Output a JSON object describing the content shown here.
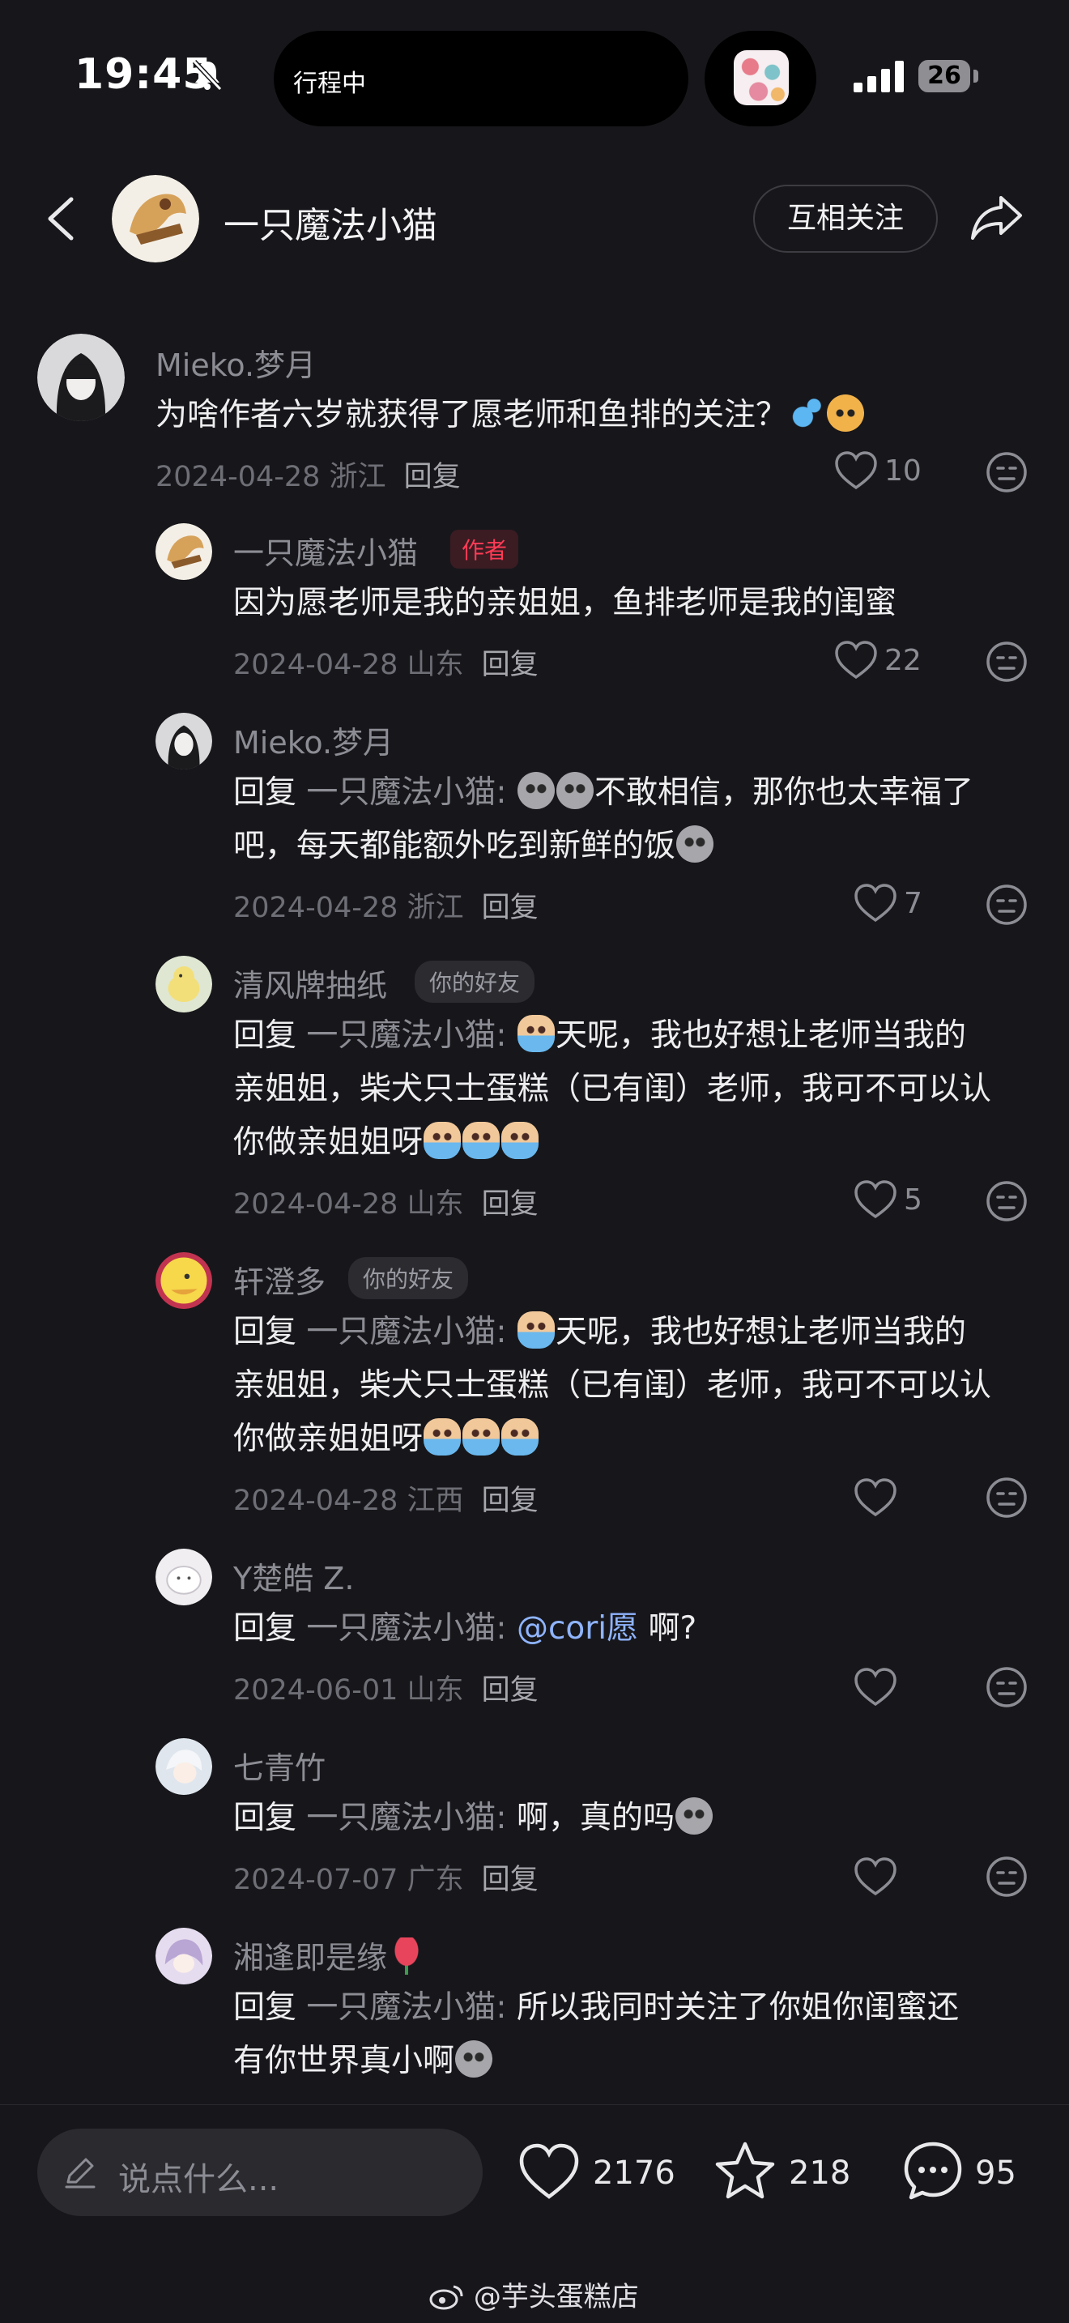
{
  "status": {
    "time": "19:45",
    "island_label": "行程中",
    "battery": "26"
  },
  "header": {
    "title": "一只魔法小猫",
    "follow_label": "互相关注"
  },
  "comments": [
    {
      "user": "Mieko.梦月",
      "text": "为啥作者六岁就获得了愿老师和鱼排的关注？",
      "date": "2024-04-28",
      "location": "浙江",
      "reply": "回复",
      "likes": "10"
    },
    {
      "user": "一只魔法小猫",
      "badge": "作者",
      "text": "因为愿老师是我的亲姐姐，鱼排老师是我的闺蜜",
      "date": "2024-04-28",
      "location": "山东",
      "reply": "回复",
      "likes": "22"
    },
    {
      "user": "Mieko.梦月",
      "reply_prefix": "回复",
      "reply_to": "一只魔法小猫:",
      "text1": "不敢相信，那你也太幸福了",
      "text2": "吧，每天都能额外吃到新鲜的饭",
      "date": "2024-04-28",
      "location": "浙江",
      "reply": "回复",
      "likes": "7"
    },
    {
      "user": "清风牌抽纸",
      "badge": "你的好友",
      "reply_prefix": "回复",
      "reply_to": "一只魔法小猫:",
      "text1": "天呢，我也好想让老师当我的",
      "text2": "亲姐姐，柴犬只士蛋糕（已有闺）老师，我可不可以认",
      "text3": "你做亲姐姐呀",
      "date": "2024-04-28",
      "location": "山东",
      "reply": "回复",
      "likes": "5"
    },
    {
      "user": "轩澄多",
      "badge": "你的好友",
      "reply_prefix": "回复",
      "reply_to": "一只魔法小猫:",
      "text1": "天呢，我也好想让老师当我的",
      "text2": "亲姐姐，柴犬只士蛋糕（已有闺）老师，我可不可以认",
      "text3": "你做亲姐姐呀",
      "date": "2024-04-28",
      "location": "江西",
      "reply": "回复",
      "likes": ""
    },
    {
      "user": "Y楚皓 Z.",
      "reply_prefix": "回复",
      "reply_to": "一只魔法小猫:",
      "mention": "@cori愿",
      "text1": " 啊?",
      "date": "2024-06-01",
      "location": "山东",
      "reply": "回复",
      "likes": ""
    },
    {
      "user": "七青竹",
      "reply_prefix": "回复",
      "reply_to": "一只魔法小猫:",
      "text1": " 啊，真的吗",
      "date": "2024-07-07",
      "location": "广东",
      "reply": "回复",
      "likes": ""
    },
    {
      "user": "湘逢即是缘",
      "reply_prefix": "回复",
      "reply_to": "一只魔法小猫:",
      "text1": " 所以我同时关注了你姐你闺蜜还",
      "text2": "有你世界真小啊"
    }
  ],
  "bottom": {
    "placeholder": "说点什么...",
    "likes": "2176",
    "favorites": "218",
    "comments": "95"
  },
  "watermark": "@芋头蛋糕店",
  "icons": [
    "bell-slash-icon",
    "signal-icon",
    "back-arrow-icon",
    "share-icon",
    "heart-icon",
    "dislike-face-icon",
    "pencil-icon",
    "star-icon",
    "comment-bubble-icon",
    "weibo-icon"
  ]
}
